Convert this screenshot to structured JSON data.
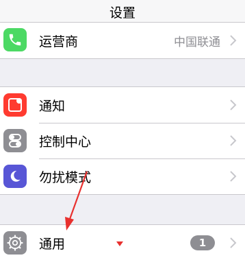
{
  "nav": {
    "title": "设置"
  },
  "groups": [
    {
      "rows": [
        {
          "label": "运营商",
          "detail": "中国联通",
          "icon": "phone-icon",
          "icon_color": "#4cd964"
        }
      ]
    },
    {
      "rows": [
        {
          "label": "通知",
          "icon": "notifications-icon",
          "icon_color": "#ff3b30"
        },
        {
          "label": "控制中心",
          "icon": "control-center-icon",
          "icon_color": "#8e8e93"
        },
        {
          "label": "勿扰模式",
          "icon": "moon-icon",
          "icon_color": "#5856d6"
        }
      ]
    },
    {
      "rows": [
        {
          "label": "通用",
          "badge": "1",
          "icon": "gear-icon",
          "icon_color": "#8e8e93"
        }
      ]
    }
  ],
  "colors": {
    "background": "#efeff4",
    "separator": "#c8c7cc",
    "chevron": "#c7c7cc",
    "annotation_arrow": "#e8302e"
  }
}
